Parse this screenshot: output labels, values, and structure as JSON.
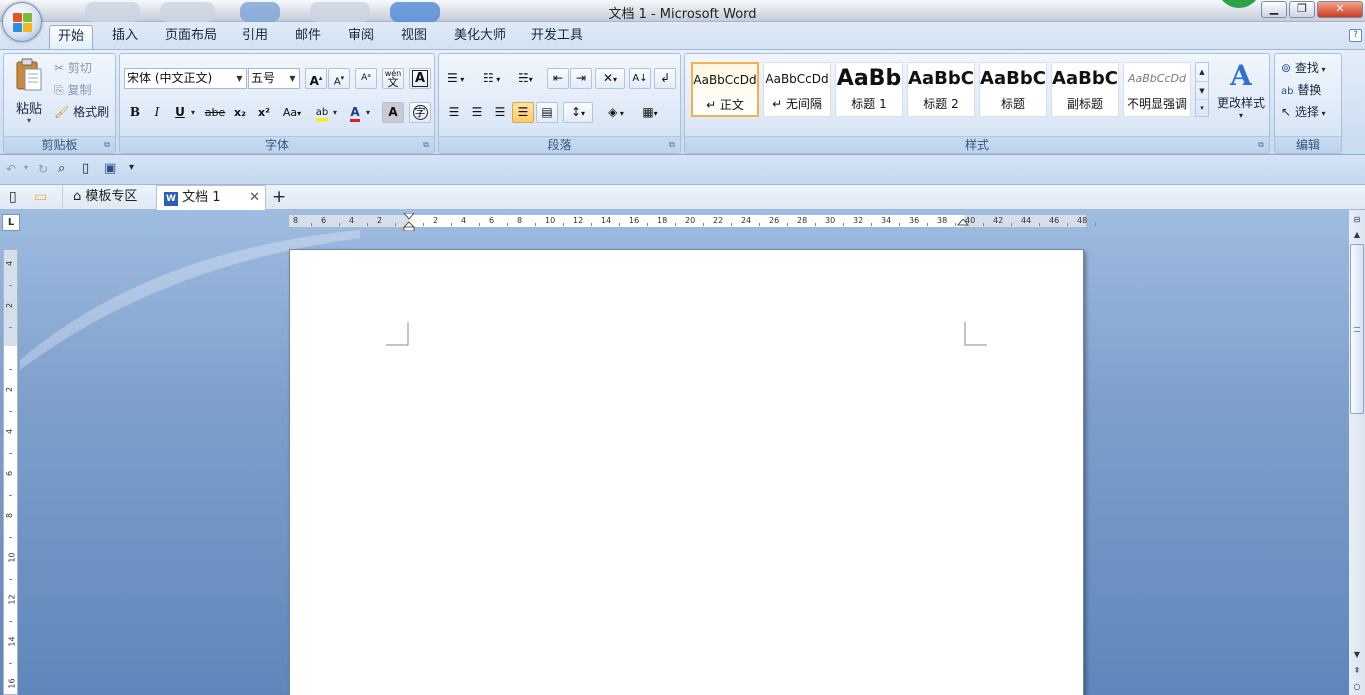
{
  "window": {
    "title": "文档 1 - Microsoft Word"
  },
  "menu_tabs": [
    "开始",
    "插入",
    "页面布局",
    "引用",
    "邮件",
    "审阅",
    "视图",
    "美化大师",
    "开发工具"
  ],
  "clipboard": {
    "paste": "粘贴",
    "cut": "剪切",
    "copy": "复制",
    "format_painter": "格式刷",
    "group": "剪贴板"
  },
  "font": {
    "name": "宋体 (中文正文)",
    "size": "五号",
    "group": "字体",
    "phonetic": "wén",
    "bold": "B",
    "italic": "I",
    "underline": "U",
    "strike": "abe",
    "subscript": "x₂",
    "superscript": "x²",
    "change_case": "Aa",
    "grow": "A",
    "shrink": "A",
    "highlight": "ab",
    "color": "A",
    "shading": "A",
    "border": "A",
    "enclose": "字"
  },
  "paragraph": {
    "group": "段落"
  },
  "styles": {
    "group": "样式",
    "items": [
      {
        "preview": "AaBbCcDd",
        "name": "↵ 正文"
      },
      {
        "preview": "AaBbCcDd",
        "name": "↵ 无间隔"
      },
      {
        "preview": "AaBb",
        "name": "标题 1"
      },
      {
        "preview": "AaBbC",
        "name": "标题 2"
      },
      {
        "preview": "AaBbC",
        "name": "标题"
      },
      {
        "preview": "AaBbC",
        "name": "副标题"
      },
      {
        "preview": "AaBbCcDd",
        "name": "不明显强调"
      }
    ],
    "change_styles": "更改样式"
  },
  "editing": {
    "find": "查找",
    "replace": "替换",
    "select": "选择",
    "group": "编辑"
  },
  "doc_tabs": {
    "template": "模板专区",
    "document": "文档 1",
    "add": "+"
  },
  "ruler": {
    "h_labels": [
      "8",
      "6",
      "4",
      "2",
      "",
      "2",
      "4",
      "6",
      "8",
      "10",
      "12",
      "14",
      "16",
      "18",
      "20",
      "22",
      "24",
      "26",
      "28",
      "30",
      "32",
      "34",
      "36",
      "38",
      "40",
      "42",
      "44",
      "46",
      "48"
    ],
    "v_labels": [
      "4",
      "2",
      "",
      "2",
      "4",
      "6",
      "8",
      "10",
      "12",
      "14",
      "16"
    ],
    "corner": "L"
  }
}
